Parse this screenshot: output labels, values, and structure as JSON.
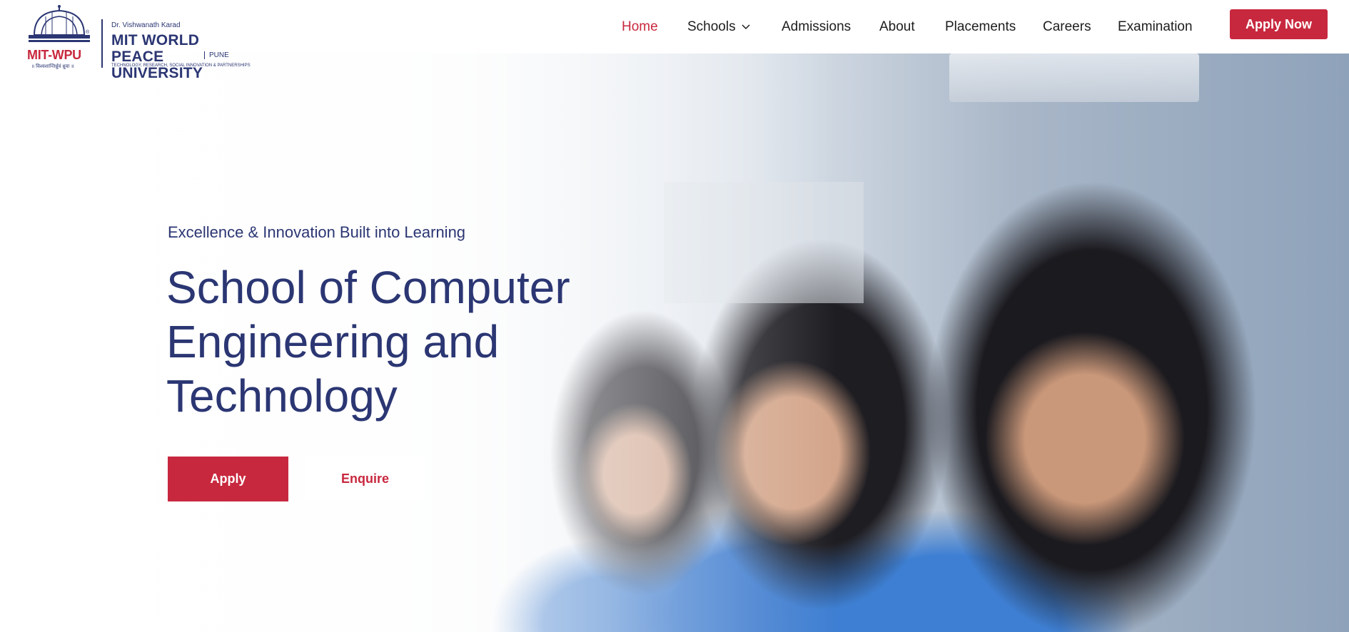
{
  "brand": {
    "name_small": "Dr. Vishwanath Karad",
    "name_line1": "MIT WORLD PEACE",
    "name_line2": "UNIVERSITY",
    "location": "PUNE",
    "tagline": "TECHNOLOGY, RESEARCH, SOCIAL INNOVATION & PARTNERSHIPS",
    "short": "MIT-WPU",
    "motto": "॥ विश्वशान्तिर्ध्रुवं ध्रुवा ॥",
    "primary_color": "#2b3673",
    "accent_color": "#c8283e"
  },
  "nav": {
    "items": [
      {
        "label": "Home",
        "active": true
      },
      {
        "label": "Schools",
        "has_dropdown": true,
        "icon": "chevron-down-icon"
      },
      {
        "label": "Admissions"
      },
      {
        "label": "About"
      },
      {
        "label": "Placements"
      },
      {
        "label": "Careers"
      },
      {
        "label": "Examination"
      }
    ],
    "cta_label": "Apply Now"
  },
  "hero": {
    "tagline": "Excellence & Innovation Built into Learning",
    "title_lines": [
      "School of Computer",
      "Engineering and",
      "Technology"
    ],
    "apply_label": "Apply",
    "enquire_label": "Enquire"
  }
}
